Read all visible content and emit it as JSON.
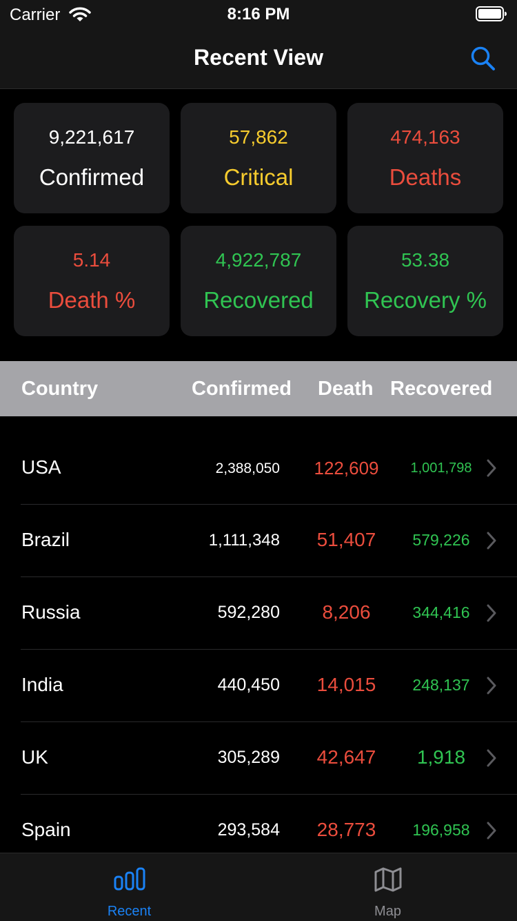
{
  "status_bar": {
    "carrier": "Carrier",
    "time": "8:16 PM"
  },
  "nav": {
    "title": "Recent View",
    "search_icon": "search-icon"
  },
  "colors": {
    "white": "#ffffff",
    "yellow": "#f7cc2e",
    "red": "#eb4d3d",
    "green": "#30c452",
    "accent": "#1a82f5"
  },
  "stats": [
    {
      "value": "9,221,617",
      "label": "Confirmed",
      "color": "white"
    },
    {
      "value": "57,862",
      "label": "Critical",
      "color": "yellow"
    },
    {
      "value": "474,163",
      "label": "Deaths",
      "color": "red"
    },
    {
      "value": "5.14",
      "label": "Death %",
      "color": "red"
    },
    {
      "value": "4,922,787",
      "label": "Recovered",
      "color": "green"
    },
    {
      "value": "53.38",
      "label": "Recovery %",
      "color": "green"
    }
  ],
  "table": {
    "headers": {
      "country": "Country",
      "confirmed": "Confirmed",
      "death": "Death",
      "recovered": "Recovered"
    },
    "rows": [
      {
        "country": "USA",
        "confirmed": "2,388,050",
        "death": "122,609",
        "recovered": "1,001,798"
      },
      {
        "country": "Brazil",
        "confirmed": "1,111,348",
        "death": "51,407",
        "recovered": "579,226"
      },
      {
        "country": "Russia",
        "confirmed": "592,280",
        "death": "8,206",
        "recovered": "344,416"
      },
      {
        "country": "India",
        "confirmed": "440,450",
        "death": "14,015",
        "recovered": "248,137"
      },
      {
        "country": "UK",
        "confirmed": "305,289",
        "death": "42,647",
        "recovered": "1,918"
      },
      {
        "country": "Spain",
        "confirmed": "293,584",
        "death": "28,773",
        "recovered": "196,958"
      }
    ]
  },
  "tabs": [
    {
      "label": "Recent",
      "icon": "bar-chart-icon",
      "selected": true
    },
    {
      "label": "Map",
      "icon": "map-icon",
      "selected": false
    }
  ]
}
